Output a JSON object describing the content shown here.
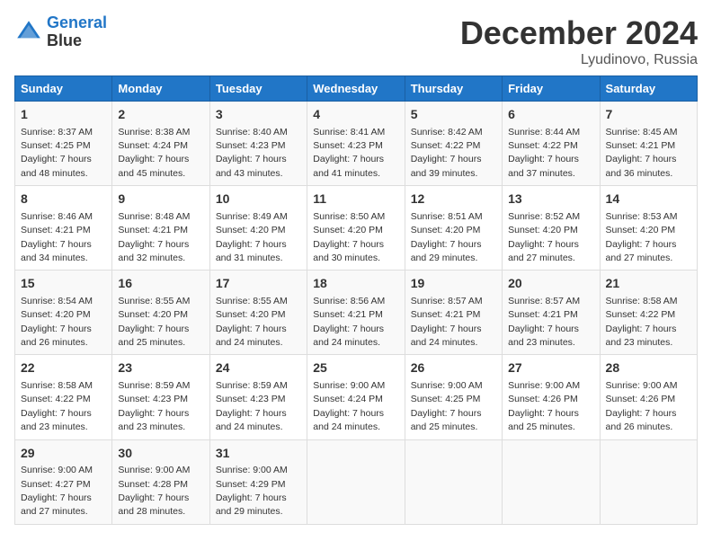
{
  "logo": {
    "line1": "General",
    "line2": "Blue"
  },
  "title": "December 2024",
  "location": "Lyudinovo, Russia",
  "days_header": [
    "Sunday",
    "Monday",
    "Tuesday",
    "Wednesday",
    "Thursday",
    "Friday",
    "Saturday"
  ],
  "weeks": [
    [
      {
        "day": "1",
        "sunrise": "8:37 AM",
        "sunset": "4:25 PM",
        "daylight": "7 hours and 48 minutes."
      },
      {
        "day": "2",
        "sunrise": "8:38 AM",
        "sunset": "4:24 PM",
        "daylight": "7 hours and 45 minutes."
      },
      {
        "day": "3",
        "sunrise": "8:40 AM",
        "sunset": "4:23 PM",
        "daylight": "7 hours and 43 minutes."
      },
      {
        "day": "4",
        "sunrise": "8:41 AM",
        "sunset": "4:23 PM",
        "daylight": "7 hours and 41 minutes."
      },
      {
        "day": "5",
        "sunrise": "8:42 AM",
        "sunset": "4:22 PM",
        "daylight": "7 hours and 39 minutes."
      },
      {
        "day": "6",
        "sunrise": "8:44 AM",
        "sunset": "4:22 PM",
        "daylight": "7 hours and 37 minutes."
      },
      {
        "day": "7",
        "sunrise": "8:45 AM",
        "sunset": "4:21 PM",
        "daylight": "7 hours and 36 minutes."
      }
    ],
    [
      {
        "day": "8",
        "sunrise": "8:46 AM",
        "sunset": "4:21 PM",
        "daylight": "7 hours and 34 minutes."
      },
      {
        "day": "9",
        "sunrise": "8:48 AM",
        "sunset": "4:21 PM",
        "daylight": "7 hours and 32 minutes."
      },
      {
        "day": "10",
        "sunrise": "8:49 AM",
        "sunset": "4:20 PM",
        "daylight": "7 hours and 31 minutes."
      },
      {
        "day": "11",
        "sunrise": "8:50 AM",
        "sunset": "4:20 PM",
        "daylight": "7 hours and 30 minutes."
      },
      {
        "day": "12",
        "sunrise": "8:51 AM",
        "sunset": "4:20 PM",
        "daylight": "7 hours and 29 minutes."
      },
      {
        "day": "13",
        "sunrise": "8:52 AM",
        "sunset": "4:20 PM",
        "daylight": "7 hours and 27 minutes."
      },
      {
        "day": "14",
        "sunrise": "8:53 AM",
        "sunset": "4:20 PM",
        "daylight": "7 hours and 27 minutes."
      }
    ],
    [
      {
        "day": "15",
        "sunrise": "8:54 AM",
        "sunset": "4:20 PM",
        "daylight": "7 hours and 26 minutes."
      },
      {
        "day": "16",
        "sunrise": "8:55 AM",
        "sunset": "4:20 PM",
        "daylight": "7 hours and 25 minutes."
      },
      {
        "day": "17",
        "sunrise": "8:55 AM",
        "sunset": "4:20 PM",
        "daylight": "7 hours and 24 minutes."
      },
      {
        "day": "18",
        "sunrise": "8:56 AM",
        "sunset": "4:21 PM",
        "daylight": "7 hours and 24 minutes."
      },
      {
        "day": "19",
        "sunrise": "8:57 AM",
        "sunset": "4:21 PM",
        "daylight": "7 hours and 24 minutes."
      },
      {
        "day": "20",
        "sunrise": "8:57 AM",
        "sunset": "4:21 PM",
        "daylight": "7 hours and 23 minutes."
      },
      {
        "day": "21",
        "sunrise": "8:58 AM",
        "sunset": "4:22 PM",
        "daylight": "7 hours and 23 minutes."
      }
    ],
    [
      {
        "day": "22",
        "sunrise": "8:58 AM",
        "sunset": "4:22 PM",
        "daylight": "7 hours and 23 minutes."
      },
      {
        "day": "23",
        "sunrise": "8:59 AM",
        "sunset": "4:23 PM",
        "daylight": "7 hours and 23 minutes."
      },
      {
        "day": "24",
        "sunrise": "8:59 AM",
        "sunset": "4:23 PM",
        "daylight": "7 hours and 24 minutes."
      },
      {
        "day": "25",
        "sunrise": "9:00 AM",
        "sunset": "4:24 PM",
        "daylight": "7 hours and 24 minutes."
      },
      {
        "day": "26",
        "sunrise": "9:00 AM",
        "sunset": "4:25 PM",
        "daylight": "7 hours and 25 minutes."
      },
      {
        "day": "27",
        "sunrise": "9:00 AM",
        "sunset": "4:26 PM",
        "daylight": "7 hours and 25 minutes."
      },
      {
        "day": "28",
        "sunrise": "9:00 AM",
        "sunset": "4:26 PM",
        "daylight": "7 hours and 26 minutes."
      }
    ],
    [
      {
        "day": "29",
        "sunrise": "9:00 AM",
        "sunset": "4:27 PM",
        "daylight": "7 hours and 27 minutes."
      },
      {
        "day": "30",
        "sunrise": "9:00 AM",
        "sunset": "4:28 PM",
        "daylight": "7 hours and 28 minutes."
      },
      {
        "day": "31",
        "sunrise": "9:00 AM",
        "sunset": "4:29 PM",
        "daylight": "7 hours and 29 minutes."
      },
      null,
      null,
      null,
      null
    ]
  ],
  "labels": {
    "sunrise": "Sunrise:",
    "sunset": "Sunset:",
    "daylight": "Daylight:"
  }
}
